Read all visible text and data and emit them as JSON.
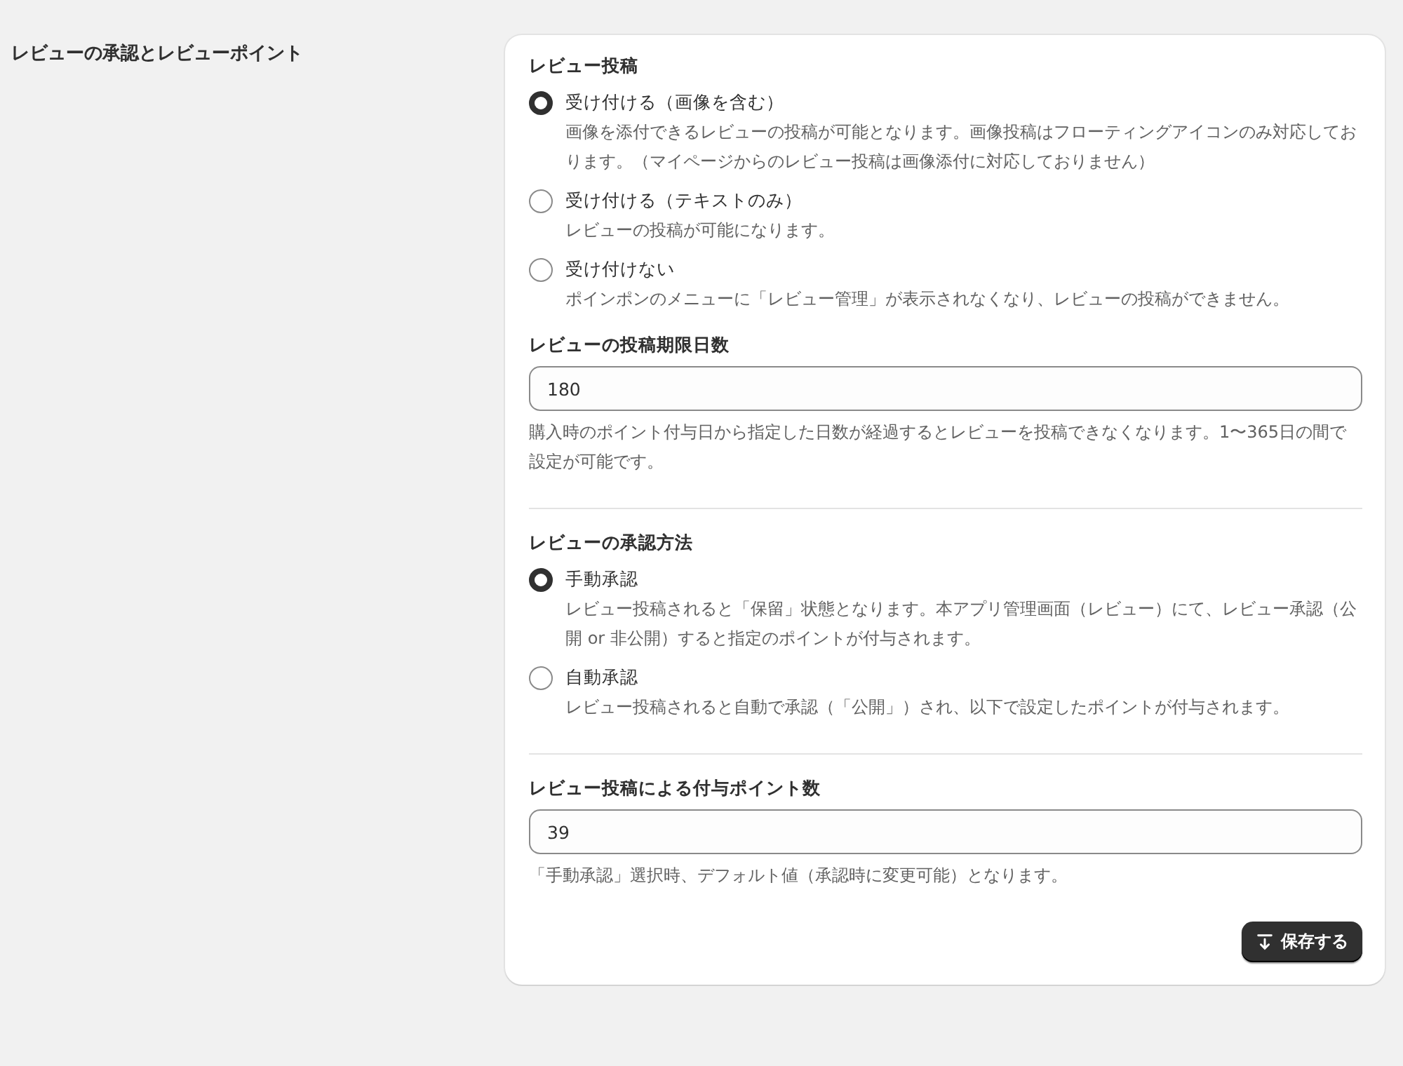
{
  "section_title": "レビューの承認とレビューポイント",
  "groups": [
    {
      "blocks": [
        {
          "kind": "radio",
          "label": "レビュー投稿",
          "options": [
            {
              "label": "受け付ける（画像を含む）",
              "selected": true,
              "description": "画像を添付できるレビューの投稿が可能となります。画像投稿はフローティングアイコンのみ対応しております。（マイページからのレビュー投稿は画像添付に対応しておりません）"
            },
            {
              "label": "受け付ける（テキストのみ）",
              "selected": false,
              "description": "レビューの投稿が可能になります。"
            },
            {
              "label": "受け付けない",
              "selected": false,
              "description": "ポインポンのメニューに「レビュー管理」が表示されなくなり、レビューの投稿ができません。"
            }
          ]
        },
        {
          "kind": "field",
          "label": "レビューの投稿期限日数",
          "value": "180",
          "help": "購入時のポイント付与日から指定した日数が経過するとレビューを投稿できなくなります。1〜365日の間で設定が可能です。"
        }
      ]
    },
    {
      "blocks": [
        {
          "kind": "radio",
          "label": "レビューの承認方法",
          "options": [
            {
              "label": "手動承認",
              "selected": true,
              "description": "レビュー投稿されると「保留」状態となります。本アプリ管理画面（レビュー）にて、レビュー承認（公開 or 非公開）すると指定のポイントが付与されます。"
            },
            {
              "label": "自動承認",
              "selected": false,
              "description": "レビュー投稿されると自動で承認（「公開」）され、以下で設定したポイントが付与されます。"
            }
          ]
        }
      ]
    },
    {
      "blocks": [
        {
          "kind": "field",
          "label": "レビュー投稿による付与ポイント数",
          "value": "39",
          "help": "「手動承認」選択時、デフォルト値（承認時に変更可能）となります。"
        }
      ]
    }
  ],
  "save_button": "保存する"
}
